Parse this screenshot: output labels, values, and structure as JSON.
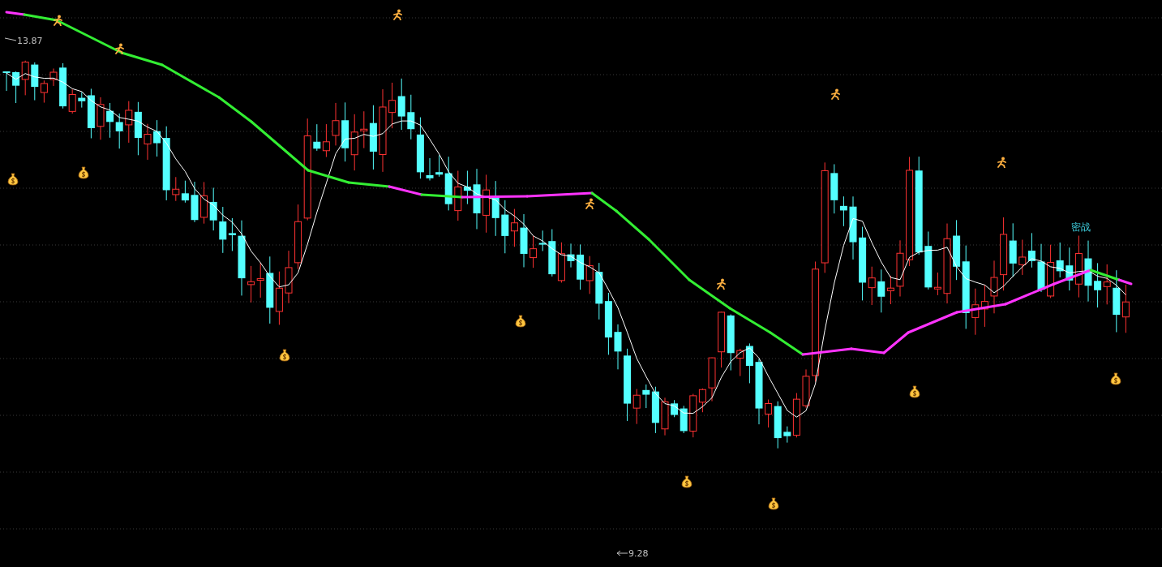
{
  "chart": {
    "high_label": "13.87",
    "low_label": "9.28",
    "signal_label": "密战"
  }
}
